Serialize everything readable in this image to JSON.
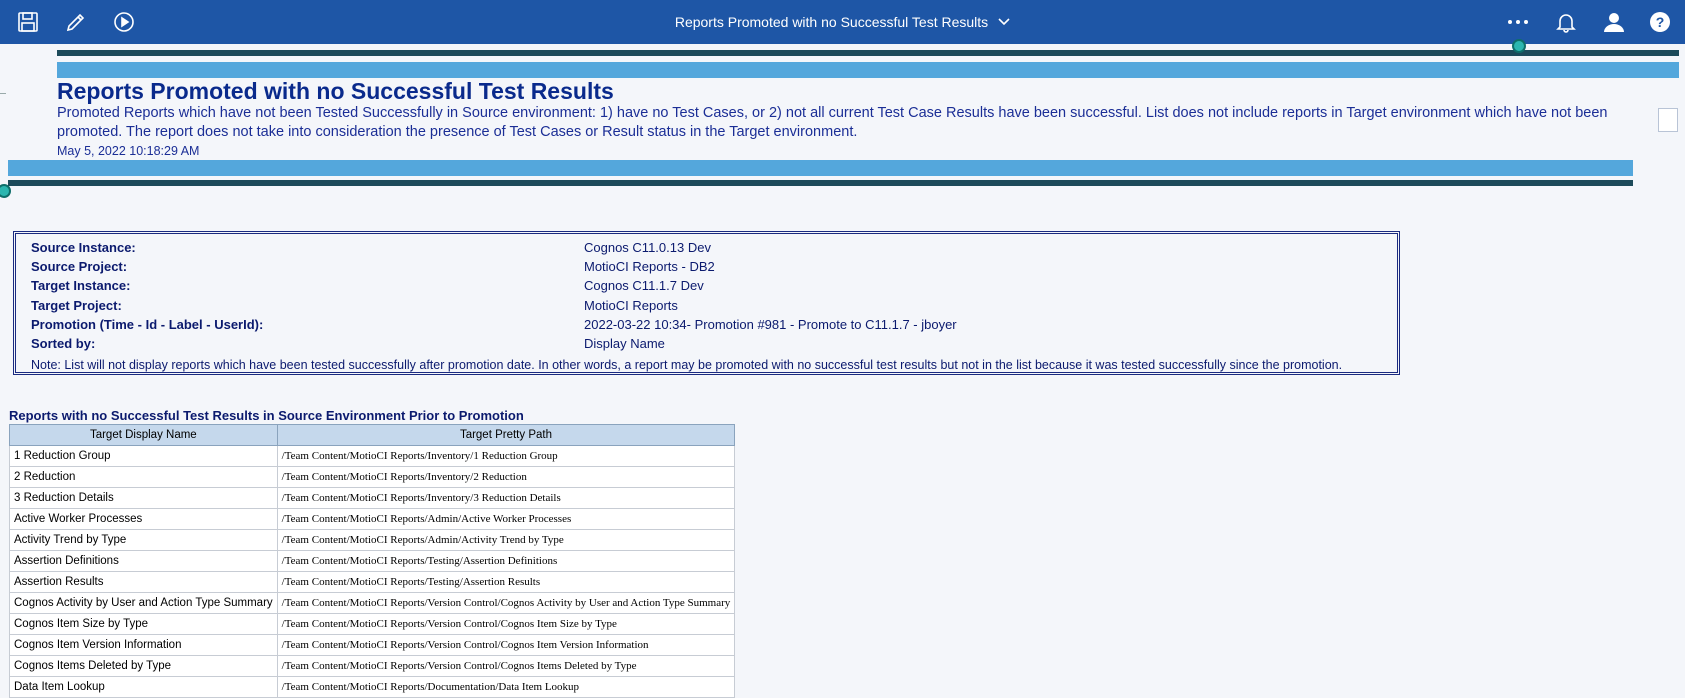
{
  "appbar": {
    "title": "Reports Promoted with no Successful Test Results",
    "icons": [
      "save-icon",
      "edit-pencil-icon",
      "run-play-icon",
      "more-ellipsis-icon",
      "notifications-bell-icon",
      "user-avatar-icon",
      "help-icon"
    ],
    "color": "#1e56a6"
  },
  "report": {
    "title": "Reports Promoted with no Successful Test Results",
    "description": "Promoted Reports which have not been Tested Successfully in Source environment:  1) have no Test Cases, or 2) not all current Test Case Results have been successful.  List does not include reports in Target environment which have not been promoted.  The report does not take into consideration the presence of Test Cases or Result status in the Target environment.",
    "date": "May 5, 2022 10:18:29 AM"
  },
  "info": {
    "rows": [
      {
        "label": "Source Instance:",
        "value": "Cognos C11.0.13 Dev"
      },
      {
        "label": "Source Project:",
        "value": "MotioCI Reports - DB2"
      },
      {
        "label": "Target Instance:",
        "value": "Cognos C11.1.7 Dev"
      },
      {
        "label": "Target Project:",
        "value": "MotioCI Reports"
      },
      {
        "label": "Promotion (Time - Id - Label - UserId):",
        "value": "2022-03-22 10:34- Promotion #981 - Promote to C11.1.7 - jboyer"
      },
      {
        "label": "Sorted by:",
        "value": "Display Name"
      }
    ],
    "note": "Note: List will not display reports which have been tested successfully after promotion date.  In other words, a report may be promoted with no successful test results but not in the list because it was tested successfully since the promotion."
  },
  "list": {
    "title": "Reports with no Successful Test Results in Source Environment Prior to Promotion",
    "columns": [
      "Target Display Name",
      "Target Pretty Path"
    ],
    "rows": [
      [
        "1 Reduction Group",
        "/Team Content/MotioCI Reports/Inventory/1 Reduction Group"
      ],
      [
        "2 Reduction",
        "/Team Content/MotioCI Reports/Inventory/2 Reduction"
      ],
      [
        "3 Reduction Details",
        "/Team Content/MotioCI Reports/Inventory/3 Reduction Details"
      ],
      [
        "Active Worker Processes",
        "/Team Content/MotioCI Reports/Admin/Active Worker Processes"
      ],
      [
        "Activity Trend by Type",
        "/Team Content/MotioCI Reports/Admin/Activity Trend by Type"
      ],
      [
        "Assertion Definitions",
        "/Team Content/MotioCI Reports/Testing/Assertion Definitions"
      ],
      [
        "Assertion Results",
        "/Team Content/MotioCI Reports/Testing/Assertion Results"
      ],
      [
        "Cognos Activity by User and Action Type Summary",
        "/Team Content/MotioCI Reports/Version Control/Cognos Activity by User and Action Type Summary"
      ],
      [
        "Cognos Item Size by Type",
        "/Team Content/MotioCI Reports/Version Control/Cognos Item Size by Type"
      ],
      [
        "Cognos Item Version Information",
        "/Team Content/MotioCI Reports/Version Control/Cognos Item Version Information"
      ],
      [
        "Cognos Items Deleted by Type",
        "/Team Content/MotioCI Reports/Version Control/Cognos Items Deleted by Type"
      ],
      [
        "Data Item Lookup",
        "/Team Content/MotioCI Reports/Documentation/Data Item Lookup"
      ]
    ]
  }
}
